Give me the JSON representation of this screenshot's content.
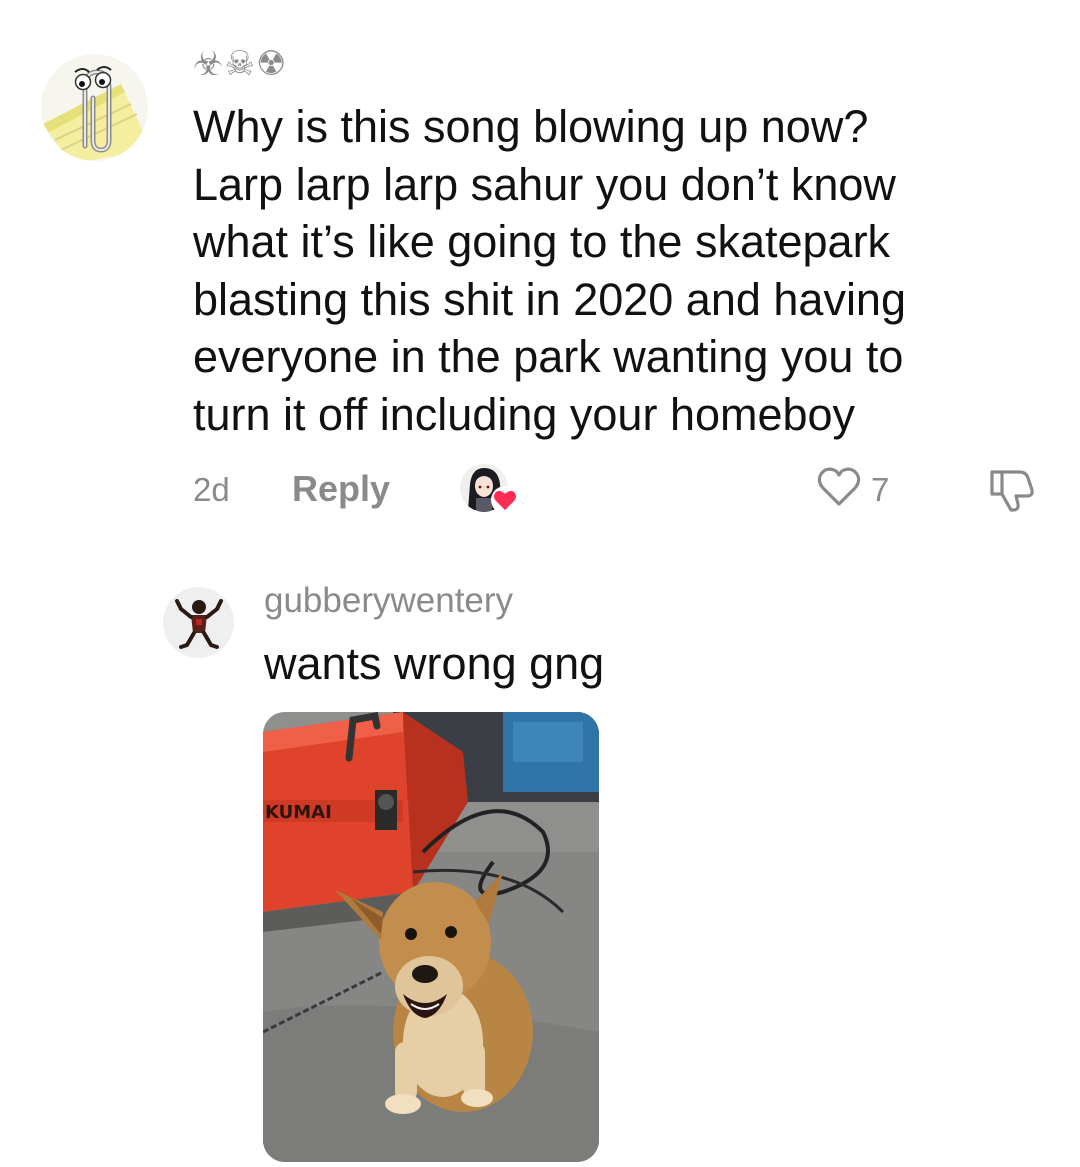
{
  "comment": {
    "username": "☣☠☢",
    "avatar_icon": "clippy-paperclip-avatar",
    "text": "Why is this song blowing up now?\nLarp larp larp sahur you don’t know\nwhat it’s like going to the skatepark\nblasting this shit in 2020 and having\neveryone in the park wanting you to\nturn it off including your homeboy",
    "time_ago": "2d",
    "reply_label": "Reply",
    "creator_liked_icon": "creator-avatar-with-heart-icon",
    "like_icon": "heart-outline-icon",
    "like_count": "7",
    "dislike_icon": "thumbs-down-outline-icon"
  },
  "reply": {
    "username": "gubberywentery",
    "avatar_icon": "dancing-figure-avatar",
    "text": "wants wrong gng",
    "image": {
      "subject": "tan dog on a chain next to a red welding machine",
      "welder_brand_text": "KUMAI"
    }
  },
  "colors": {
    "text_primary": "#111111",
    "text_secondary": "#8a8a8a",
    "heart_red": "#fe2c55",
    "background": "#ffffff"
  }
}
